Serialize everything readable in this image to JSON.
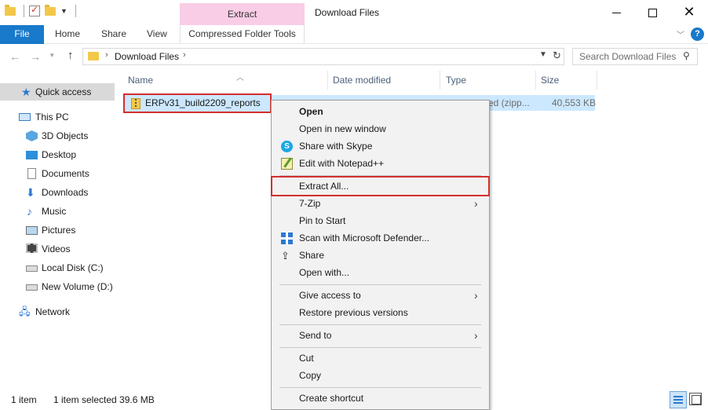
{
  "window": {
    "title": "Download Files",
    "contextual_group": "Extract"
  },
  "ribbon": {
    "tabs": [
      "File",
      "Home",
      "Share",
      "View",
      "Compressed Folder Tools"
    ]
  },
  "address": {
    "path": "Download Files",
    "search_placeholder": "Search Download Files"
  },
  "nav": {
    "items": [
      {
        "label": "Quick access",
        "icon": "star-icon"
      },
      {
        "label": "This PC",
        "icon": "computer-icon"
      },
      {
        "label": "3D Objects",
        "icon": "3d-objects-icon"
      },
      {
        "label": "Desktop",
        "icon": "desktop-icon"
      },
      {
        "label": "Documents",
        "icon": "documents-icon"
      },
      {
        "label": "Downloads",
        "icon": "downloads-icon"
      },
      {
        "label": "Music",
        "icon": "music-icon"
      },
      {
        "label": "Pictures",
        "icon": "pictures-icon"
      },
      {
        "label": "Videos",
        "icon": "videos-icon"
      },
      {
        "label": "Local Disk (C:)",
        "icon": "local-disk-icon"
      },
      {
        "label": "New Volume (D:)",
        "icon": "drive-icon"
      },
      {
        "label": "Network",
        "icon": "network-icon"
      }
    ]
  },
  "columns": [
    "Name",
    "Date modified",
    "Type",
    "Size"
  ],
  "files": [
    {
      "name": "ERPv31_build2209_reports",
      "type_visible": "ed (zipp...",
      "size": "40,553 KB"
    }
  ],
  "context_menu": {
    "items": [
      {
        "label": "Open"
      },
      {
        "label": "Open in new window"
      },
      {
        "label": "Share with Skype"
      },
      {
        "label": "Edit with Notepad++"
      },
      {
        "label": "Extract All..."
      },
      {
        "label": "7-Zip"
      },
      {
        "label": "Pin to Start"
      },
      {
        "label": "Scan with Microsoft Defender..."
      },
      {
        "label": "Share"
      },
      {
        "label": "Open with..."
      },
      {
        "label": "Give access to"
      },
      {
        "label": "Restore previous versions"
      },
      {
        "label": "Send to"
      },
      {
        "label": "Cut"
      },
      {
        "label": "Copy"
      },
      {
        "label": "Create shortcut"
      }
    ]
  },
  "status": {
    "count": "1 item",
    "selection": "1 item selected  39.6 MB"
  },
  "colors": {
    "accent": "#1979ca",
    "contextual_tab": "#f9cde6",
    "selection": "#cce8ff",
    "highlight_box": "#d32f2f"
  }
}
